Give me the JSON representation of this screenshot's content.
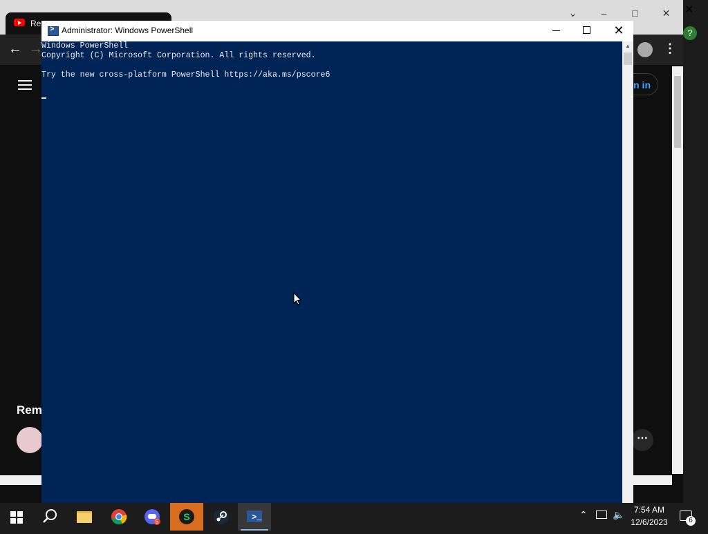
{
  "browser": {
    "tab_title": "Re",
    "sign_in": "n in",
    "section_heading": "Rem",
    "more_label": "⋯",
    "extension_label": "?"
  },
  "powershell": {
    "window_title": "Administrator: Windows PowerShell",
    "console_lines": [
      "Windows PowerShell",
      "Copyright (C) Microsoft Corporation. All rights reserved.",
      "",
      "Try the new cross-platform PowerShell https://aka.ms/pscore6"
    ],
    "console_bg": "#012456",
    "console_fg": "#eeedf0"
  },
  "taskbar": {
    "apps": [
      "start-icon",
      "search-icon",
      "file-explorer-icon",
      "chrome-icon",
      "discord-icon",
      "app-icon",
      "steam-icon",
      "powershell-icon"
    ],
    "discord_badge": "5",
    "active_app": "powershell-icon",
    "clock": {
      "time": "7:54 AM",
      "date": "12/6/2023"
    },
    "notification_count": "6"
  }
}
